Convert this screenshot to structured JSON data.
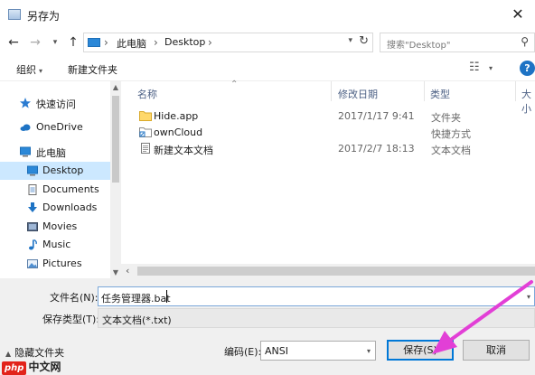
{
  "window": {
    "title": "另存为",
    "close_glyph": "✕"
  },
  "address": {
    "crumbs": [
      "此电脑",
      "Desktop"
    ],
    "search_placeholder": "搜索\"Desktop\""
  },
  "toolbar": {
    "organize": "组织",
    "new_folder": "新建文件夹",
    "help": "?"
  },
  "nav": {
    "items": [
      {
        "label": "快速访问",
        "icon": "star-icon",
        "top": true
      },
      {
        "label": "OneDrive",
        "icon": "cloud-icon",
        "top": true
      },
      {
        "label": "此电脑",
        "icon": "computer-icon",
        "top": true
      },
      {
        "label": "Desktop",
        "icon": "desktop-icon",
        "selected": true
      },
      {
        "label": "Documents",
        "icon": "document-icon"
      },
      {
        "label": "Downloads",
        "icon": "download-icon"
      },
      {
        "label": "Movies",
        "icon": "movie-icon"
      },
      {
        "label": "Music",
        "icon": "music-icon"
      },
      {
        "label": "Pictures",
        "icon": "picture-icon"
      }
    ]
  },
  "columns": {
    "name": "名称",
    "date": "修改日期",
    "type": "类型",
    "size": "大小"
  },
  "files": [
    {
      "name": "Hide.app",
      "date": "2017/1/17 9:41",
      "type": "文件夹",
      "icon": "folder-icon"
    },
    {
      "name": "ownCloud",
      "date": "",
      "type": "快捷方式",
      "icon": "shortcut-folder-icon"
    },
    {
      "name": "新建文本文档",
      "date": "2017/2/7 18:13",
      "type": "文本文档",
      "icon": "text-file-icon"
    }
  ],
  "bottom": {
    "filename_label": "文件名(N):",
    "filename_value": "任务管理器.bat",
    "filetype_label": "保存类型(T):",
    "filetype_value": "文本文档(*.txt)",
    "hide_folders": "隐藏文件夹",
    "encoding_label": "编码(E):",
    "encoding_value": "ANSI",
    "save_label": "保存(S)",
    "cancel_label": "取消"
  },
  "watermark": {
    "badge": "php",
    "site": "中文网"
  },
  "colors": {
    "accent": "#0078d7",
    "selection": "#cce8ff",
    "annotation": "#e23fd6"
  }
}
